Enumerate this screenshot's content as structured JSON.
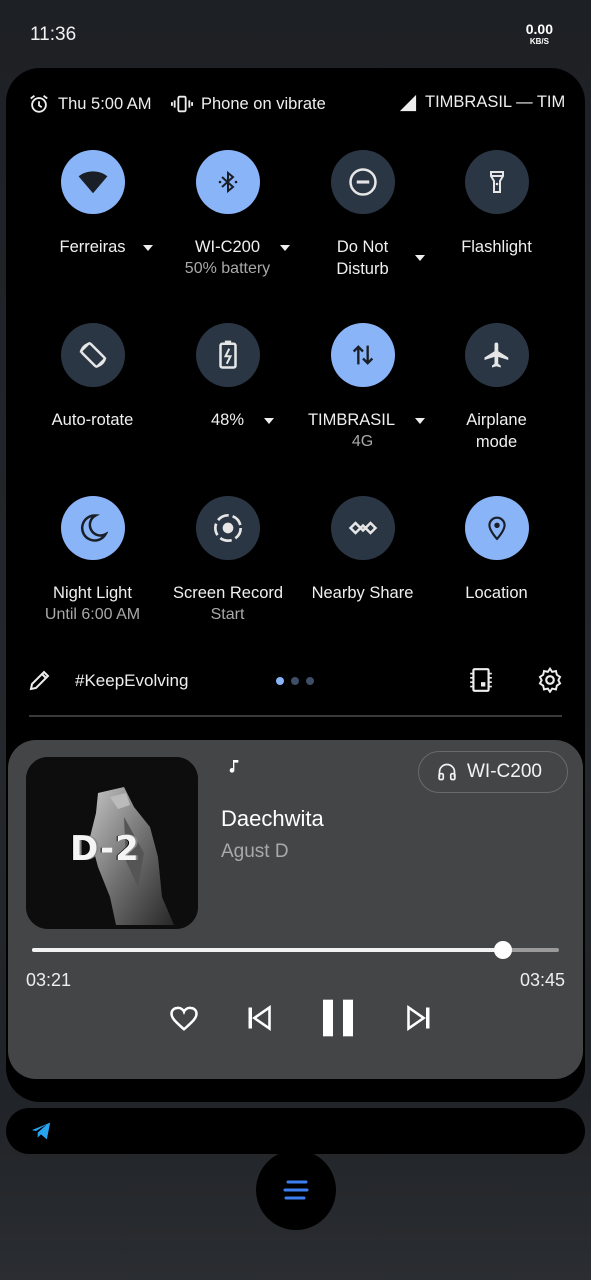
{
  "status_bar": {
    "time": "11:36",
    "net_speed": "0.00",
    "net_unit": "KB/S"
  },
  "info_bar": {
    "alarm": "Thu 5:00 AM",
    "ringer": "Phone on vibrate",
    "carrier": "TIMBRASIL — TIM"
  },
  "tiles": [
    {
      "icon": "wifi-icon",
      "label": "Ferreiras",
      "sub": "",
      "on": true
    },
    {
      "icon": "bluetooth-icon",
      "label": "WI-C200",
      "sub": "50% battery",
      "on": true
    },
    {
      "icon": "do-not-disturb-icon",
      "label": "Do Not",
      "label2": "Disturb",
      "on": false
    },
    {
      "icon": "flashlight-icon",
      "label": "Flashlight",
      "on": false
    },
    {
      "icon": "auto-rotate-icon",
      "label": "Auto-rotate",
      "on": false
    },
    {
      "icon": "battery-saver-icon",
      "label": "48%",
      "on": false
    },
    {
      "icon": "mobile-data-icon",
      "label": "TIMBRASIL",
      "sub": "4G",
      "on": true
    },
    {
      "icon": "airplane-icon",
      "label": "Airplane",
      "label2": "mode",
      "on": false
    },
    {
      "icon": "night-light-icon",
      "label": "Night Light",
      "sub": "Until 6:00 AM",
      "on": true
    },
    {
      "icon": "screen-record-icon",
      "label": "Screen Record",
      "sub": "Start",
      "on": false
    },
    {
      "icon": "nearby-share-icon",
      "label": "Nearby Share",
      "on": false
    },
    {
      "icon": "location-icon",
      "label": "Location",
      "on": true
    }
  ],
  "footer": {
    "build_name": "#KeepEvolving",
    "page_count": 3,
    "active_page": 0
  },
  "media": {
    "output_device": "WI-C200",
    "song_title": "Daechwita",
    "artist": "Agust D",
    "album_art_text": "D-2",
    "elapsed": "03:21",
    "duration": "03:45",
    "progress": 0.894
  },
  "colors": {
    "accent": "#8ab4f8",
    "tile_off": "#2b3644",
    "media_bg": "#444546",
    "telegram": "#2aa3ef"
  }
}
